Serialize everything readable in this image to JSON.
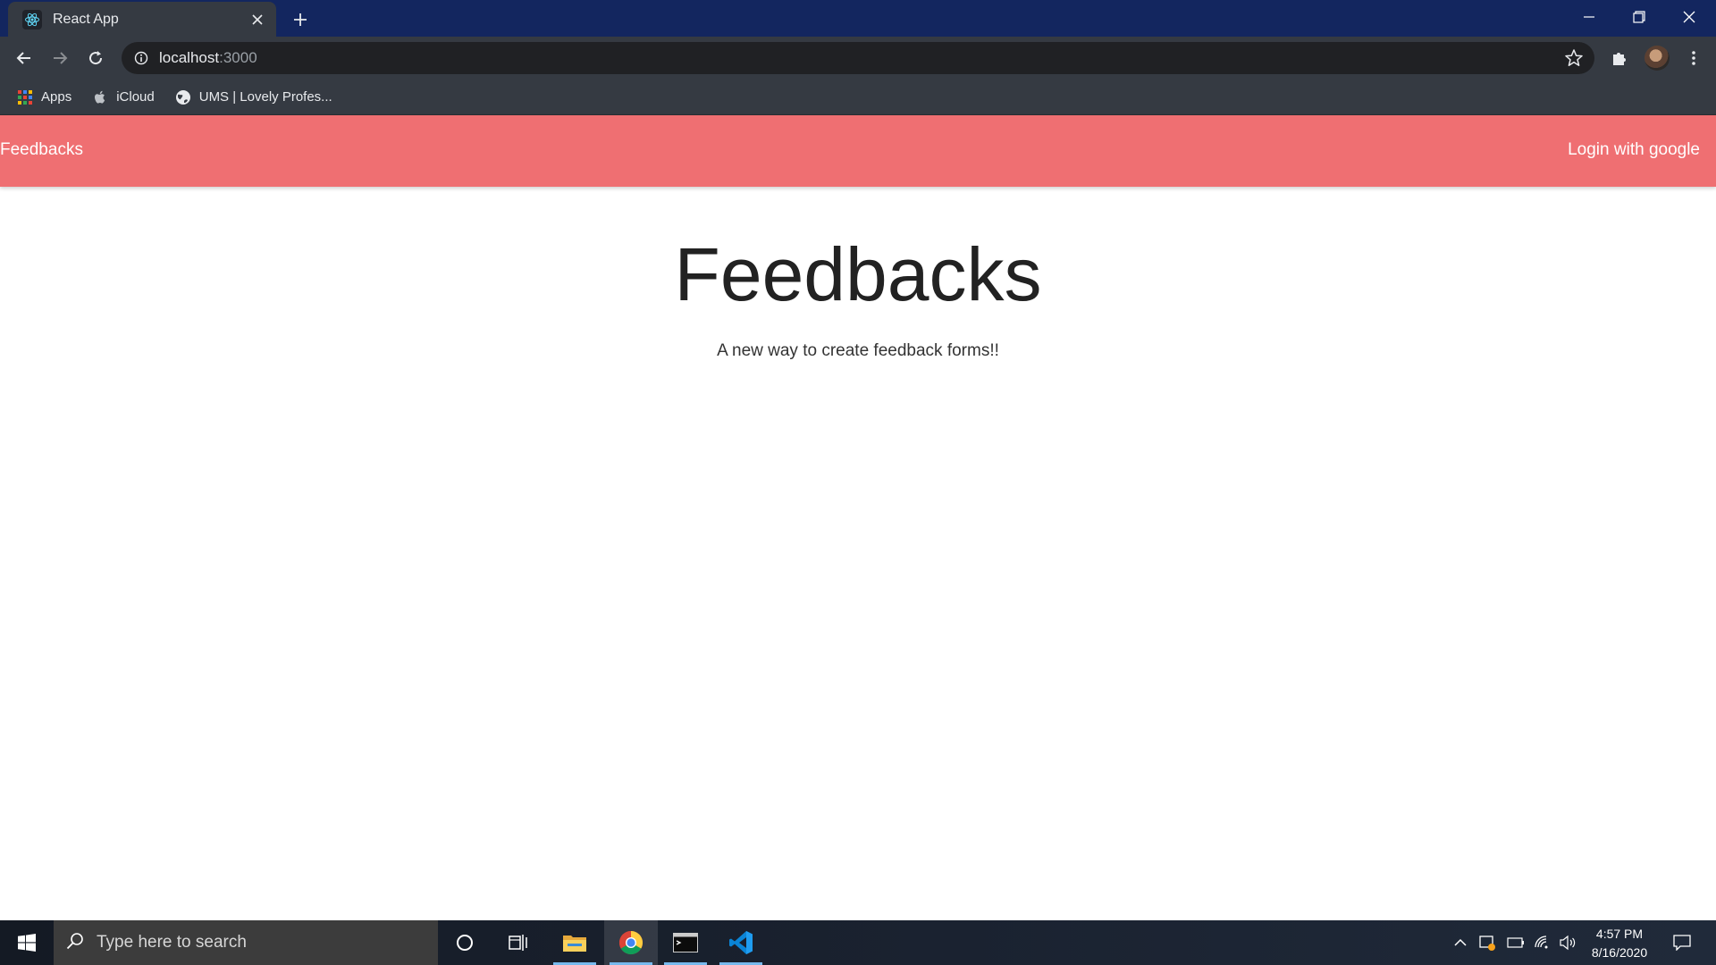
{
  "browser": {
    "tab_title": "React App",
    "address_host": "localhost",
    "address_port": ":3000",
    "bookmarks": [
      {
        "label": "Apps",
        "icon": "apps-grid-icon"
      },
      {
        "label": "iCloud",
        "icon": "apple-icon"
      },
      {
        "label": "UMS | Lovely Profes...",
        "icon": "globe-icon"
      }
    ]
  },
  "navbar": {
    "brand": "Feedbacks",
    "login": "Login with google",
    "background": "#ef6f72"
  },
  "hero": {
    "title": "Feedbacks",
    "subtitle": "A new way to create feedback forms!!"
  },
  "taskbar": {
    "search_placeholder": "Type here to search",
    "time": "4:57 PM",
    "date": "8/16/2020",
    "apps": [
      "cortana-icon",
      "task-view-icon",
      "file-explorer-icon",
      "chrome-icon",
      "terminal-icon",
      "vscode-icon"
    ]
  }
}
